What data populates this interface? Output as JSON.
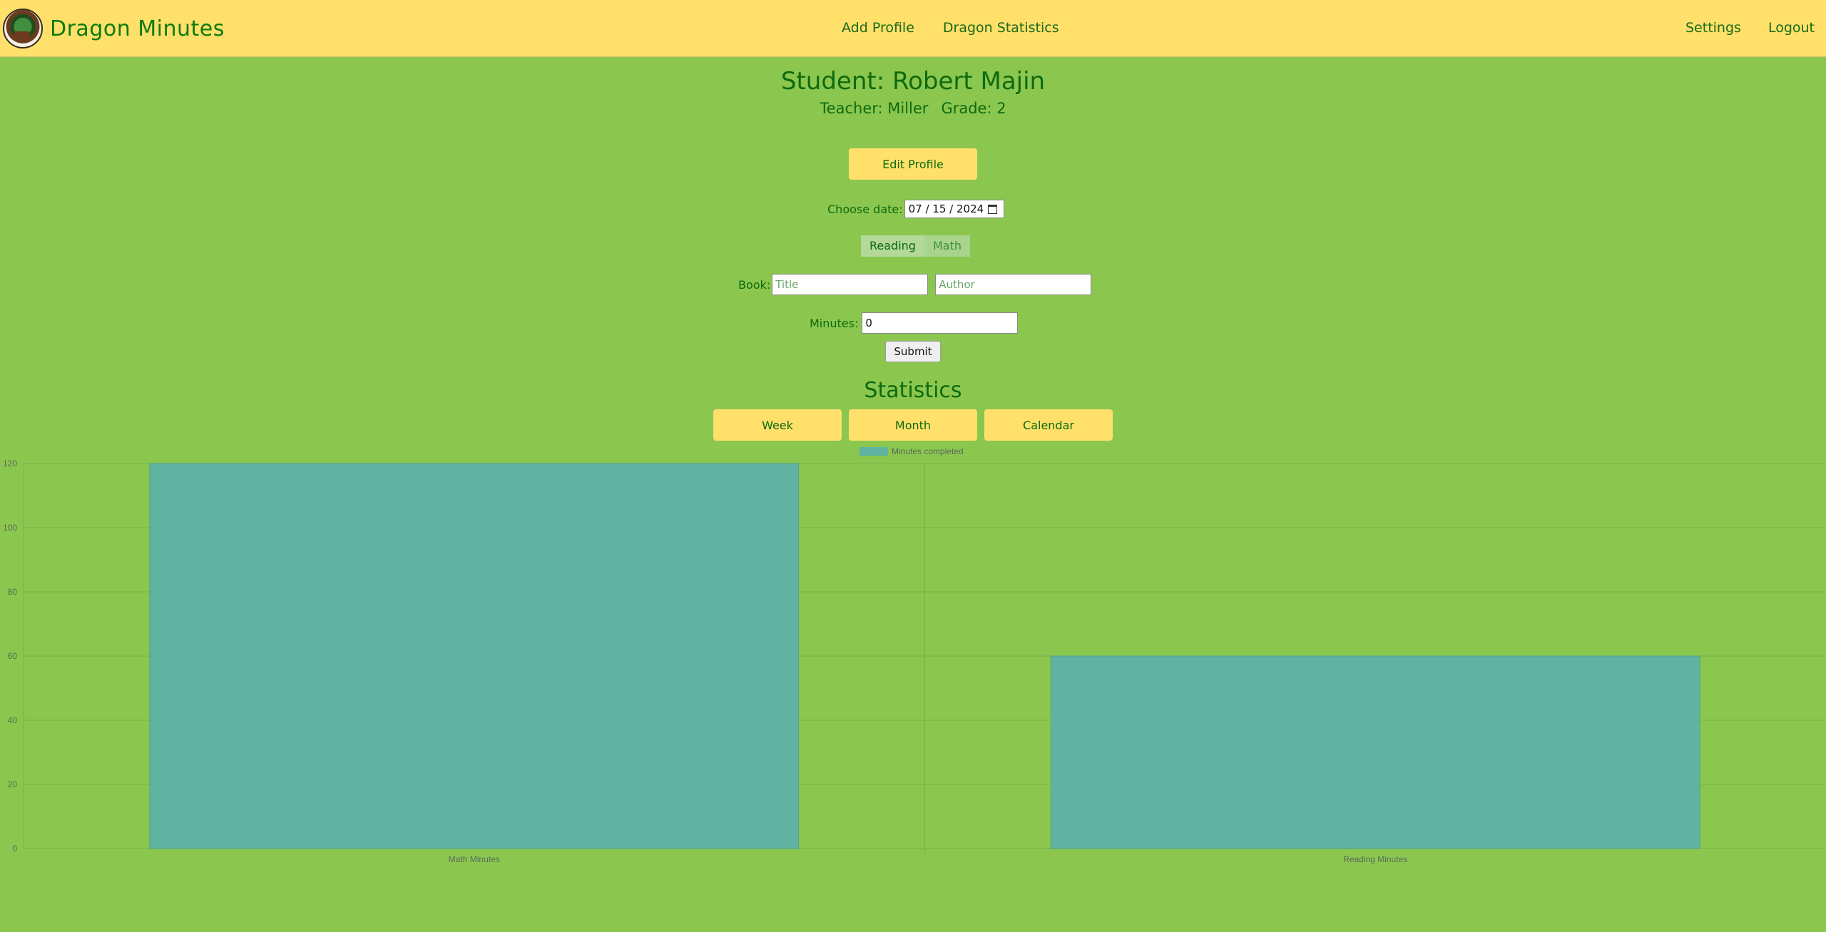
{
  "app": {
    "brand": "Dragon Minutes"
  },
  "nav": {
    "center": [
      "Add Profile",
      "Dragon Statistics"
    ],
    "right": [
      "Settings",
      "Logout"
    ]
  },
  "student": {
    "title": "Student: Robert Majin",
    "teacher": "Teacher: Miller",
    "grade": "Grade: 2"
  },
  "edit_button": "Edit Profile",
  "date": {
    "label": "Choose date:",
    "value": "07 / 15 / 2024"
  },
  "tabs": [
    {
      "label": "Reading",
      "active": true
    },
    {
      "label": "Math",
      "active": false
    }
  ],
  "book": {
    "label": "Book:",
    "title_placeholder": "Title",
    "author_placeholder": "Author"
  },
  "minutes": {
    "label": "Minutes:",
    "value": "0"
  },
  "submit_label": "Submit",
  "statistics": {
    "heading": "Statistics",
    "buttons": [
      "Week",
      "Month",
      "Calendar"
    ]
  },
  "colors": {
    "background": "#8bc74f",
    "navbar": "#fee06b",
    "bar": "#5fb3a0"
  },
  "chart_data": {
    "type": "bar",
    "categories": [
      "Math Minutes",
      "Reading Minutes"
    ],
    "series": [
      {
        "name": "Minutes completed",
        "values": [
          120,
          60
        ]
      }
    ],
    "ylim": [
      0,
      120
    ],
    "yticks": [
      0,
      20,
      40,
      60,
      80,
      100,
      120
    ],
    "grid": true,
    "legend": "top"
  }
}
